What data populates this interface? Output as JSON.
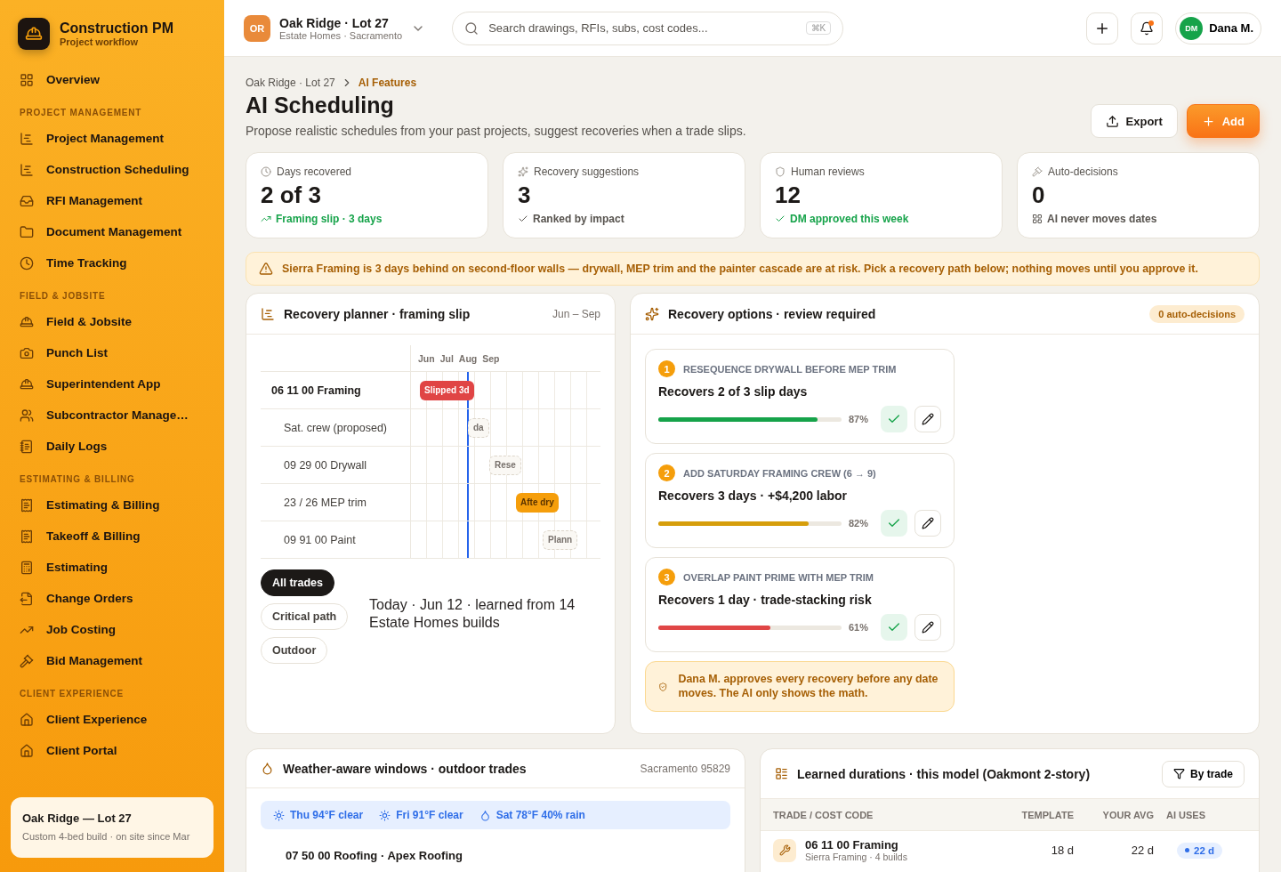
{
  "brand": {
    "name": "Construction PM",
    "subtitle": "Project workflow"
  },
  "sidebar": {
    "top": {
      "label": "Overview",
      "selected": false
    },
    "sections": [
      {
        "title": "PROJECT MANAGEMENT",
        "items": [
          {
            "label": "Project Management",
            "selected": false
          },
          {
            "label": "Construction Scheduling",
            "selected": false
          },
          {
            "label": "RFI Management",
            "selected": false
          },
          {
            "label": "Document Management",
            "selected": false
          },
          {
            "label": "Time Tracking",
            "selected": false
          }
        ]
      },
      {
        "title": "FIELD & JOBSITE",
        "items": [
          {
            "label": "Field & Jobsite",
            "selected": false
          },
          {
            "label": "Punch List",
            "selected": false
          },
          {
            "label": "Superintendent App",
            "selected": false
          },
          {
            "label": "Subcontractor Manage…",
            "selected": false
          },
          {
            "label": "Daily Logs",
            "selected": false
          }
        ]
      },
      {
        "title": "ESTIMATING & BILLING",
        "items": [
          {
            "label": "Estimating & Billing",
            "selected": false
          },
          {
            "label": "Takeoff & Billing",
            "selected": false
          },
          {
            "label": "Estimating",
            "selected": false
          },
          {
            "label": "Change Orders",
            "selected": false
          },
          {
            "label": "Job Costing",
            "selected": false
          },
          {
            "label": "Bid Management",
            "selected": false
          }
        ]
      },
      {
        "title": "CLIENT EXPERIENCE",
        "items": [
          {
            "label": "Client Experience",
            "selected": false
          },
          {
            "label": "Client Portal",
            "selected": false
          }
        ]
      }
    ],
    "project_card": {
      "title": "Oak Ridge — Lot 27",
      "description": "Custom 4-bed build · on site since Mar"
    }
  },
  "topbar": {
    "project": {
      "initials": "OR",
      "name": "Oak Ridge · Lot 27",
      "subtitle": "Estate Homes · Sacramento"
    },
    "search": {
      "placeholder": "Search drawings, RFIs, subs, cost codes...",
      "shortcut": "⌘K"
    },
    "notifications": {
      "unread": true
    },
    "user": {
      "initials": "DM",
      "name": "Dana M."
    }
  },
  "breadcrumb": [
    "Oak Ridge · Lot 27",
    "AI Features"
  ],
  "page": {
    "title": "AI Scheduling",
    "subtitle": "Propose realistic schedules from your past projects, suggest recoveries when a trade slips.",
    "buttons": [
      {
        "label": "Export",
        "kind": "secondary"
      },
      {
        "label": "Add",
        "kind": "primary"
      }
    ]
  },
  "stats": [
    {
      "kind": "clock",
      "label": "Days recovered",
      "value": "2 of 3",
      "note": "Framing slip · 3 days",
      "positive": true
    },
    {
      "kind": "sparkle",
      "label": "Recovery suggestions",
      "value": "3",
      "note": "Ranked by impact",
      "positive": false
    },
    {
      "kind": "shield",
      "label": "Human reviews",
      "value": "12",
      "note": "DM approved this week",
      "positive": true
    },
    {
      "kind": "gavel",
      "label": "Auto-decisions",
      "value": "0",
      "note": "AI never moves dates",
      "positive": false
    }
  ],
  "alert": "Sierra Framing is 3 days behind on second-floor walls — drywall, MEP trim and the painter cascade are at risk. Pick a recovery path below; nothing moves until you approve it.",
  "planner": {
    "title": "Recovery planner · framing slip",
    "range": "Jun – Sep",
    "months": [
      "Jun",
      "Jul",
      "Aug",
      "Sep"
    ],
    "rows": [
      {
        "label": "06 11 00 Framing",
        "bar": "Slipped 3d",
        "kind": "slipped"
      },
      {
        "label": "Sat. crew (proposed)",
        "bar": "da",
        "kind": "planned"
      },
      {
        "label": "09 29 00 Drywall",
        "bar": "Rese",
        "kind": "planned"
      },
      {
        "label": "23 / 26 MEP trim",
        "bar": "Afte dry",
        "kind": "after"
      },
      {
        "label": "09 91 00 Paint",
        "bar": "Plann",
        "kind": "planned"
      }
    ],
    "filters": [
      {
        "label": "All trades",
        "selected": true
      },
      {
        "label": "Critical path",
        "selected": false
      },
      {
        "label": "Outdoor",
        "selected": false
      }
    ],
    "note": "Today · Jun 12 · learned from 14 Estate Homes builds"
  },
  "options": {
    "title": "Recovery options · review required",
    "badge": "0 auto-decisions",
    "items": [
      {
        "number": "1",
        "title": "RESEQUENCE DRYWALL BEFORE MEP TRIM",
        "summary": "Recovers 2 of 3 slip days",
        "level": 0.87,
        "reading": "87%",
        "color": "#16a34a"
      },
      {
        "number": "2",
        "title": "ADD SATURDAY FRAMING CREW (6 → 9)",
        "summary": "Recovers 3 days · +$4,200 labor",
        "level": 0.82,
        "reading": "82%",
        "color": "#d69e0b"
      },
      {
        "number": "3",
        "title": "OVERLAP PAINT PRIME WITH MEP TRIM",
        "summary": "Recovers 1 day · trade-stacking risk",
        "level": 0.61,
        "reading": "61%",
        "color": "#e04646"
      }
    ],
    "notice": "Dana M. approves every recovery before any date moves. The AI only shows the math."
  },
  "weather": {
    "title": "Weather-aware windows · outdoor trades",
    "location": "Sacramento 95829",
    "forecast": [
      {
        "label": "Thu 94°F clear",
        "kind": "sun"
      },
      {
        "label": "Fri 91°F clear",
        "kind": "sun"
      },
      {
        "label": "Sat 78°F 40% rain",
        "kind": "rain"
      }
    ],
    "rows": [
      {
        "label": "07 50 00 Roofing · Apex Roofing"
      }
    ]
  },
  "durations": {
    "title": "Learned durations · this model (Oakmont 2-story)",
    "filter": "By trade",
    "columns": [
      "TRADE / COST CODE",
      "TEMPLATE",
      "YOUR AVG",
      "AI USES"
    ],
    "rows": [
      {
        "name": "06 11 00 Framing",
        "detail": "Sierra Framing · 4 builds",
        "template": "18 d",
        "average": "22 d",
        "ai_uses": "22 d"
      }
    ]
  }
}
